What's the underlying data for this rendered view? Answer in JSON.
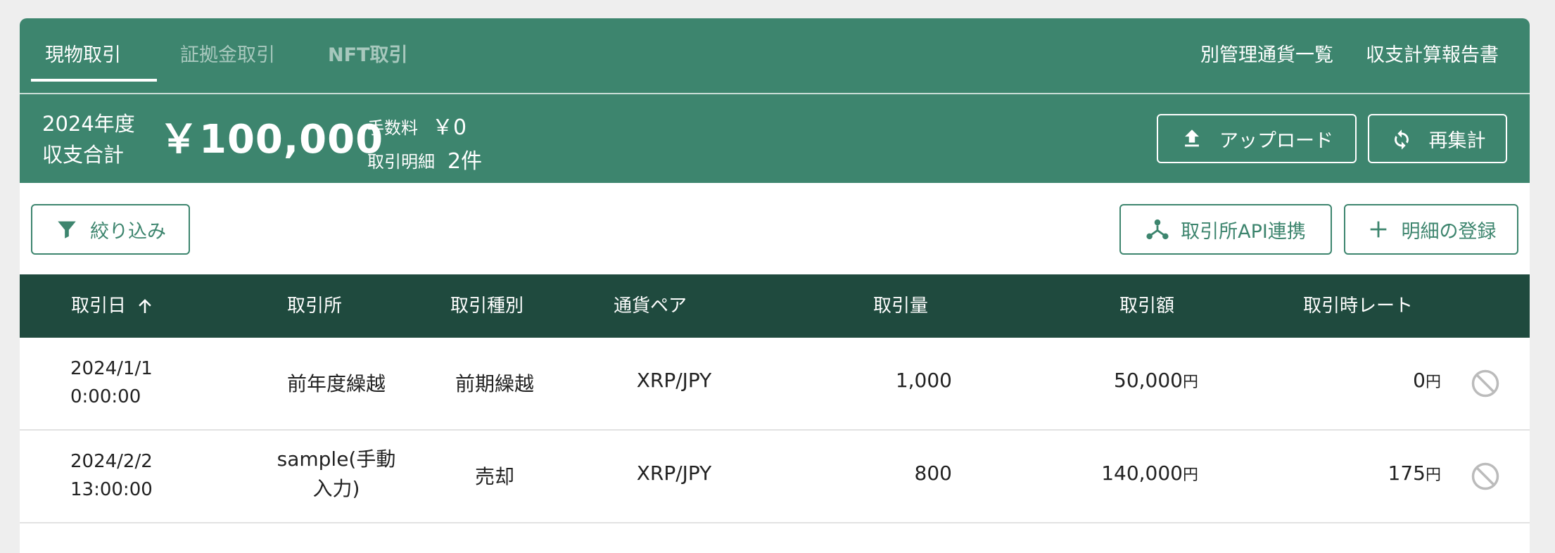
{
  "tabs": [
    {
      "label": "現物取引",
      "active": true
    },
    {
      "label": "証拠金取引",
      "active": false
    },
    {
      "label": "NFT取引",
      "active": false
    }
  ],
  "header_links": [
    "別管理通貨一覧",
    "収支計算報告書"
  ],
  "summary": {
    "year_line1": "2024年度",
    "year_line2": "収支合計",
    "total": "￥100,000",
    "fee_label": "手数料",
    "fee_value": "￥0",
    "count_label": "取引明細",
    "count_value": "2件",
    "upload_label": "アップロード",
    "recalc_label": "再集計"
  },
  "actions": {
    "filter_label": "絞り込み",
    "api_label": "取引所API連携",
    "register_label": "明細の登録"
  },
  "table": {
    "headers": [
      "取引日",
      "取引所",
      "取引種別",
      "通貨ペア",
      "取引量",
      "取引額",
      "取引時レート"
    ],
    "currency_suffix": "円",
    "rows": [
      {
        "date": "2024/1/1",
        "time": "0:00:00",
        "exchange_line1": "前年度繰越",
        "exchange_line2": "",
        "type": "前期繰越",
        "pair": "XRP/JPY",
        "amount": "1,000",
        "value": "50,000",
        "rate": "0"
      },
      {
        "date": "2024/2/2",
        "time": "13:00:00",
        "exchange_line1": "sample(手動",
        "exchange_line2": "入力)",
        "type": "売却",
        "pair": "XRP/JPY",
        "amount": "800",
        "value": "140,000",
        "rate": "175"
      }
    ]
  },
  "colors": {
    "brand": "#3d856e",
    "table_header": "#1f4a3e",
    "disabled_icon": "#bbbbbb"
  }
}
